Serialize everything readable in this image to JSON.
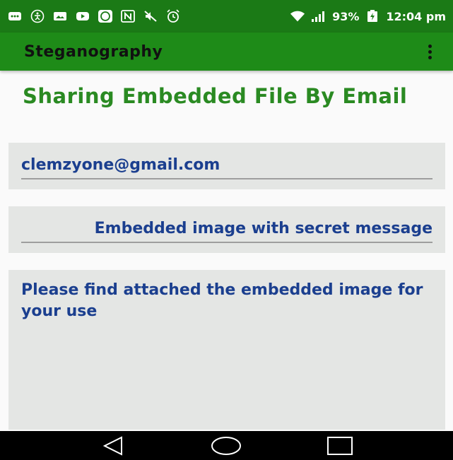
{
  "status_bar": {
    "battery": "93%",
    "time": "12:04 pm"
  },
  "app_bar": {
    "title": "Steganography"
  },
  "content": {
    "heading": "Sharing Embedded File By Email",
    "email_value": "clemzyone@gmail.com",
    "subject_value": "Embedded image with secret message",
    "message_value": "Please find attached the embedded image for your use"
  },
  "icons": {
    "status": [
      "message-icon",
      "accessibility-icon",
      "picture-icon",
      "youtube-icon",
      "whatsapp-icon",
      "nfc-icon",
      "mute-icon",
      "alarm-icon",
      "wifi-icon",
      "signal-icon",
      "battery-charging-icon"
    ],
    "nav": [
      "back-icon",
      "home-icon",
      "recents-icon"
    ]
  },
  "colors": {
    "status_bar": "#1b7a16",
    "app_bar": "#1e8b18",
    "heading": "#2a8a22",
    "input_text": "#1b3f8f",
    "field_bg": "#e4e6e4"
  }
}
